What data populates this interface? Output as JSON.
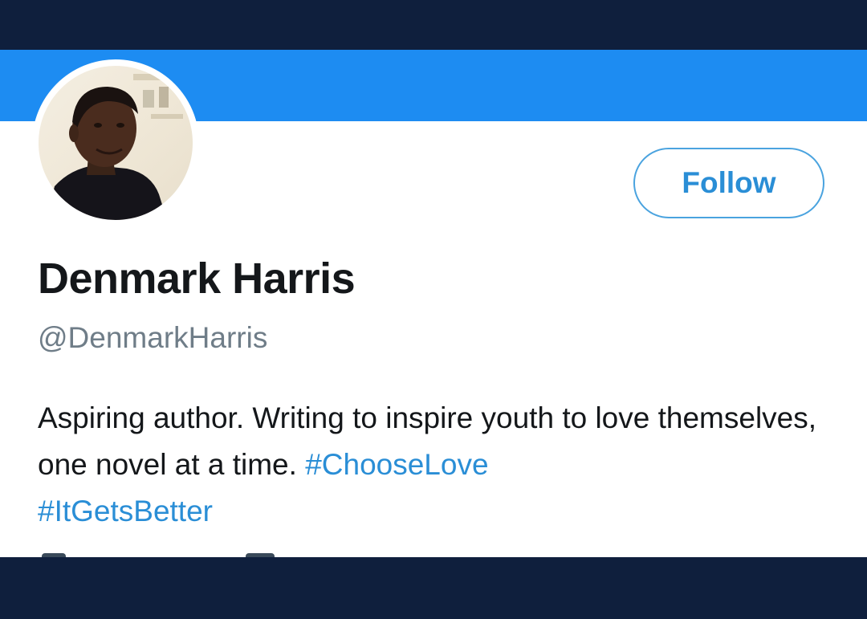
{
  "profile": {
    "name": "Denmark Harris",
    "handle": "@DenmarkHarris",
    "bio_text": "Aspiring author. Writing to inspire youth to love themselves, one novel at a time.",
    "hashtags": [
      "#ChooseLove",
      "#ItGetsBetter"
    ]
  },
  "actions": {
    "follow_label": "Follow"
  },
  "colors": {
    "banner": "#1d8cf2",
    "accent": "#2a8ed6",
    "frame": "#0f1f3d",
    "handle_text": "#6f7d88"
  },
  "icons": {
    "avatar": "profile-photo"
  }
}
